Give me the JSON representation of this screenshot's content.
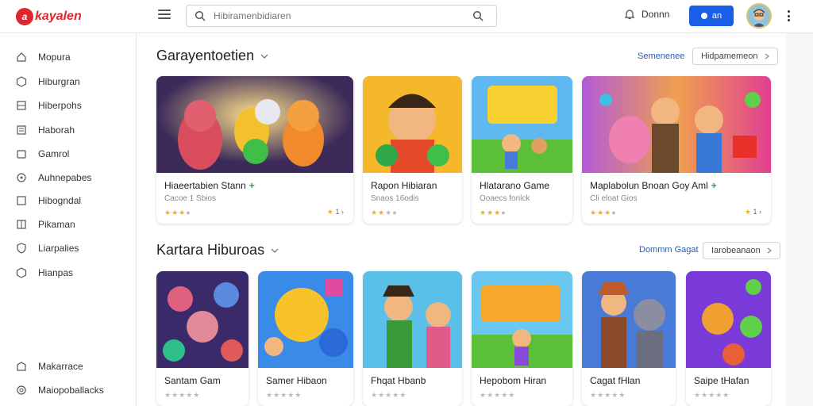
{
  "app": {
    "logo_text": "kayalen",
    "logo_boxed": "en"
  },
  "search": {
    "placeholder": "Hibiramenbidiaren"
  },
  "header": {
    "notify_label": "Donnn",
    "primary_label": "an"
  },
  "sidebar": {
    "items": [
      {
        "label": "Mopura",
        "icon": "home-icon"
      },
      {
        "label": "Hiburgran",
        "icon": "hexagon-icon"
      },
      {
        "label": "Hiberpohs",
        "icon": "grid-icon"
      },
      {
        "label": "Haborah",
        "icon": "list-icon"
      },
      {
        "label": "Gamrol",
        "icon": "gamepad-icon"
      },
      {
        "label": "Auhnepabes",
        "icon": "puzzle-icon"
      },
      {
        "label": "Hibogndal",
        "icon": "tag-icon"
      },
      {
        "label": "Pikaman",
        "icon": "box-icon"
      },
      {
        "label": "Liarpalies",
        "icon": "shield-icon"
      },
      {
        "label": "Hianpas",
        "icon": "hexagon-icon"
      }
    ],
    "bottom_items": [
      {
        "label": "Makarrace",
        "icon": "star-icon"
      },
      {
        "label": "Maiopoballacks",
        "icon": "settings-icon"
      }
    ]
  },
  "section1": {
    "title": "Garayentoetien",
    "link": "Semenenee",
    "pill": "Hidpamemeon",
    "cards": [
      {
        "title": "Hiaeertabien Stann",
        "plus": "+",
        "sub": "Cacoe 1 Sbios",
        "rating": 3,
        "rate_text": ""
      },
      {
        "title": "Rapon Hibiaran",
        "plus": "",
        "sub": "Snaos 16odis",
        "rating": 2,
        "rate_text": ""
      },
      {
        "title": "Hlatarano Game",
        "plus": "",
        "sub": "Ooaecs fonlck",
        "rating": 3,
        "rate_text": ""
      },
      {
        "title": "Maplabolun Bnoan Goy Aml",
        "plus": "+",
        "sub": "Cli eloat Gios",
        "rating": 3,
        "rate_text": ""
      }
    ]
  },
  "section2": {
    "title": "Kartara Hiburoas",
    "link": "Dommm Gagat",
    "pill": "Iarobeanaon",
    "cards": [
      {
        "title": "Santam Gam"
      },
      {
        "title": "Samer Hibaon"
      },
      {
        "title": "Fhqat Hbanb"
      },
      {
        "title": "Hepobom Hiran"
      },
      {
        "title": "Cagat fHlan"
      },
      {
        "title": "Saipe tHafan"
      }
    ]
  },
  "colors": {
    "accent": "#1a5ee8",
    "brand": "#e0262d",
    "star": "#f2b01e"
  }
}
